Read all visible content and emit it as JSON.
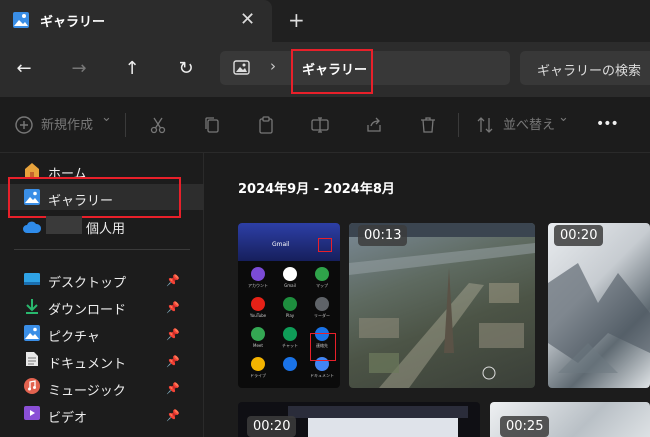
{
  "titlebar": {
    "tab_title": "ギャラリー",
    "close_glyph": "✕",
    "new_tab_glyph": "+"
  },
  "nav": {
    "back": "←",
    "forward": "→",
    "up": "↑",
    "refresh": "↻",
    "chevron": "›",
    "location": "ギャラリー",
    "search_label": "ギャラリーの検索"
  },
  "toolbar": {
    "new_label": "新規作成",
    "new_chevron": "⌄",
    "sort_label": "並べ替え",
    "sort_chevron": "⌄",
    "more": "•••"
  },
  "sidebar": {
    "items": [
      {
        "label": "ホーム",
        "icon": "home-icon"
      },
      {
        "label": "ギャラリー",
        "icon": "gallery-icon",
        "selected": true
      },
      {
        "label": "個人用",
        "icon": "onedrive-icon"
      }
    ],
    "quick_access": [
      {
        "label": "デスクトップ",
        "icon": "desktop-icon"
      },
      {
        "label": "ダウンロード",
        "icon": "download-icon"
      },
      {
        "label": "ピクチャ",
        "icon": "pictures-icon"
      },
      {
        "label": "ドキュメント",
        "icon": "documents-icon"
      },
      {
        "label": "ミュージック",
        "icon": "music-icon"
      },
      {
        "label": "ビデオ",
        "icon": "videos-icon"
      }
    ],
    "pin_glyph": "📌"
  },
  "gallery": {
    "date_range": "2024年9月 - 2024年8月",
    "phone_apps": [
      "アカウント",
      "Gmail",
      "マップ",
      "YouTube",
      "Play",
      "リーダー",
      "Meet",
      "チャット",
      "連絡先",
      "ドライブ",
      "",
      "ドキュメント"
    ],
    "phone_header": "Gmail",
    "durations": [
      "00:13",
      "00:20",
      "00:20",
      "00:25"
    ]
  },
  "colors": {
    "accent_highlight": "#e8202a",
    "background": "#1c1c1c"
  }
}
